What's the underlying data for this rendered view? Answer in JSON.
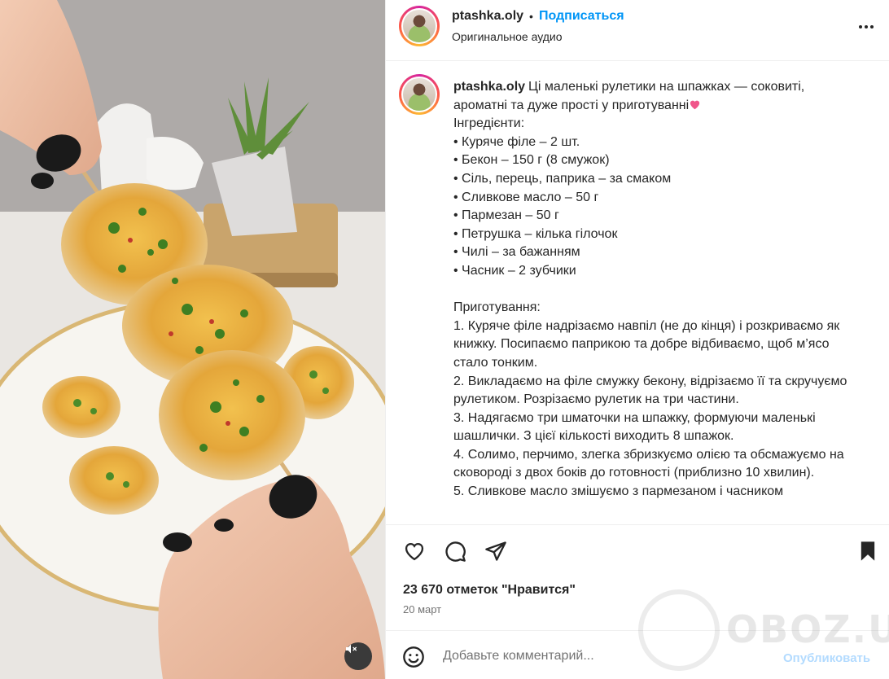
{
  "post": {
    "username": "ptashka.oly",
    "separator": "•",
    "follow_label": "Подписаться",
    "audio_label": "Оригинальное аудио",
    "caption": "Ці маленькі рулетики на шпажках — соковиті, ароматні та дуже прості у приготуванні",
    "caption_body": "\nІнгредієнти:\n• Куряче філе – 2 шт.\n• Бекон – 150 г (8 смужок)\n• Сіль, перець, паприка – за смаком\n• Сливкове масло – 50 г\n• Пармезан – 50 г\n• Петрушка – кілька гілочок\n• Чилі – за бажанням\n• Часник – 2 зубчики\n\nПриготування:\n1. Куряче філе надрізаємо навпіл (не до кінця) і розкриваємо як книжку. Посипаємо паприкою та добре відбиваємо, щоб м’ясо стало тонким.\n2. Викладаємо на філе смужку бекону, відрізаємо її та скручуємо рулетиком. Розрізаємо рулетик на три частини.\n3. Надягаємо три шматочки на шпажку, формуючи маленькі шашлички. З цієї кількості виходить 8 шпажок.\n4. Солимо, перчимо, злегка збризкуємо олією та обсмажуємо на сковороді з двох боків до готовності (приблизно 10 хвилин).\n5. Сливкове масло змішуємо з пармезаном і часником",
    "likes_label": "23 670 отметок \"Нравится\"",
    "date_label": "20 март"
  },
  "comment": {
    "placeholder": "Добавьте комментарий...",
    "publish_label": "Опубликовать"
  },
  "watermark": {
    "text": "OBOZ.UA"
  },
  "icons": {
    "like": "heart-outline-icon",
    "comment": "comment-bubble-icon",
    "share": "paper-plane-icon",
    "save": "bookmark-filled-icon",
    "more": "more-dots-icon",
    "emoji": "smiley-icon",
    "mute": "speaker-muted-icon"
  },
  "colors": {
    "accent": "#0095f6",
    "publish_disabled": "#b3dbff",
    "text": "#262626",
    "muted_text": "#737373"
  }
}
